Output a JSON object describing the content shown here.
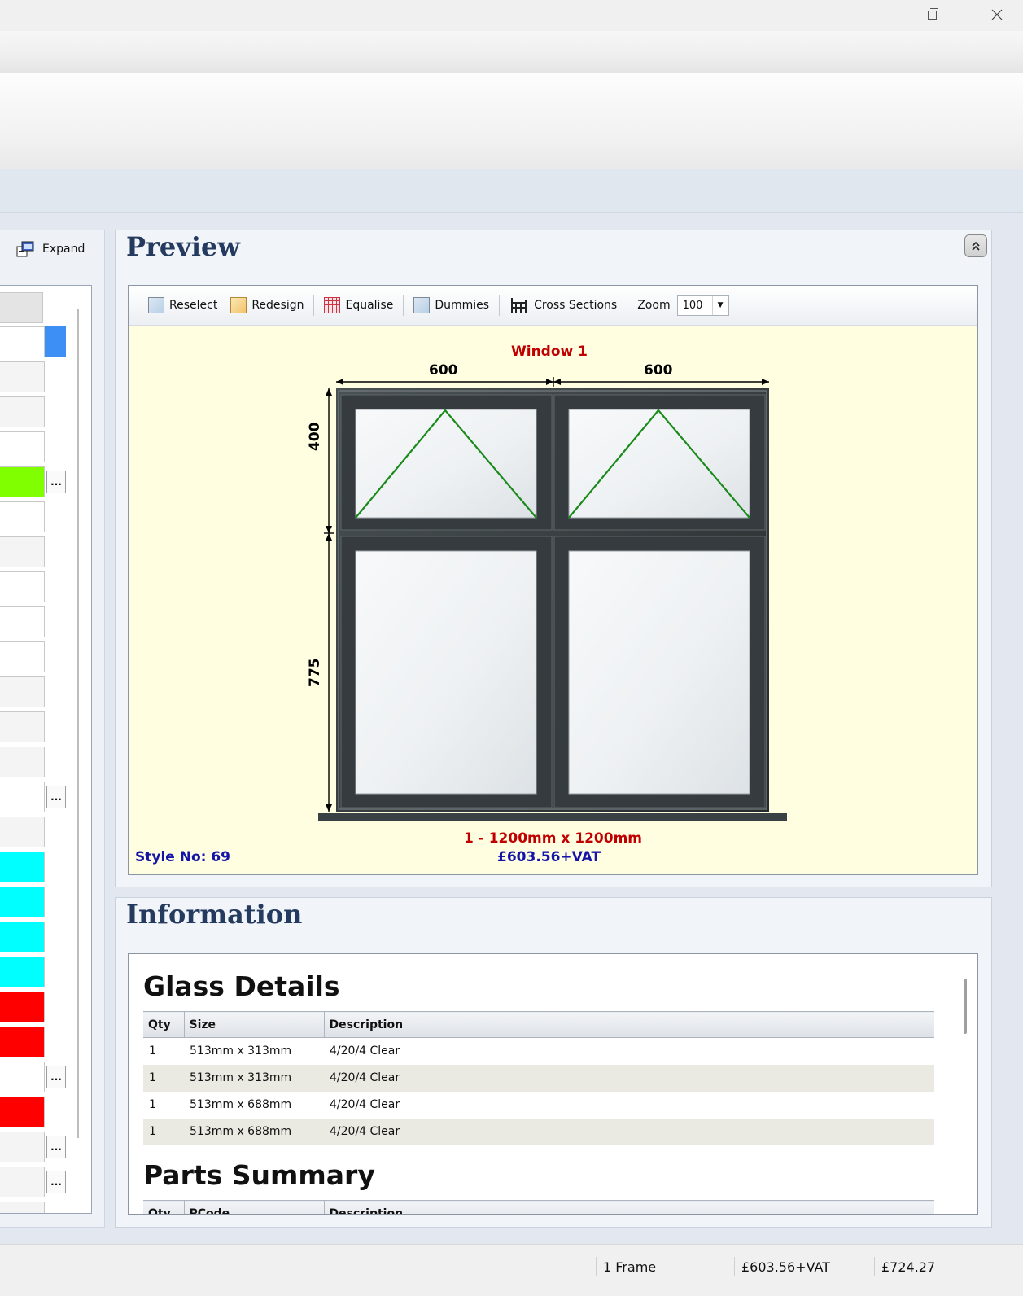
{
  "window": {
    "minimize_label": "—",
    "restore_label": "❐",
    "close_label": "✕"
  },
  "left": {
    "expand_label": "Expand",
    "cell_colors": {
      "blue": "#3d8ff5",
      "green": "#80ff00",
      "cyan": "#00ffff",
      "red": "#ff0000"
    },
    "dots_label": "..."
  },
  "preview": {
    "title": "Preview",
    "collapse_icon": "double-chevron-up-icon",
    "toolbar": {
      "reselect": "Reselect",
      "redesign": "Redesign",
      "equalise": "Equalise",
      "dummies": "Dummies",
      "cross_sections": "Cross Sections",
      "zoom_label": "Zoom",
      "zoom_value": "100"
    },
    "drawing": {
      "window_name": "Window 1",
      "width_left": "600",
      "width_right": "600",
      "height_top": "400",
      "height_bottom": "775",
      "size_caption": "1 - 1200mm x 1200mm",
      "price_caption": "£603.56+VAT",
      "style_no": "Style No: 69",
      "frame_color": "#2e3335",
      "opening_line_color": "#1a8a1a",
      "background_color": "#fffee0"
    }
  },
  "information": {
    "title": "Information",
    "glass_details": {
      "heading": "Glass Details",
      "columns": [
        "Qty",
        "Size",
        "Description"
      ],
      "rows": [
        {
          "qty": "1",
          "size": "513mm x 313mm",
          "description": "4/20/4 Clear"
        },
        {
          "qty": "1",
          "size": "513mm x 313mm",
          "description": "4/20/4 Clear"
        },
        {
          "qty": "1",
          "size": "513mm x 688mm",
          "description": "4/20/4 Clear"
        },
        {
          "qty": "1",
          "size": "513mm x 688mm",
          "description": "4/20/4 Clear"
        }
      ]
    },
    "parts_summary": {
      "heading": "Parts Summary",
      "columns": [
        "Qty",
        "PCode",
        "Description"
      ]
    }
  },
  "status": {
    "frames": "1 Frame",
    "price_ex_vat": "£603.56+VAT",
    "price_total": "£724.27"
  }
}
